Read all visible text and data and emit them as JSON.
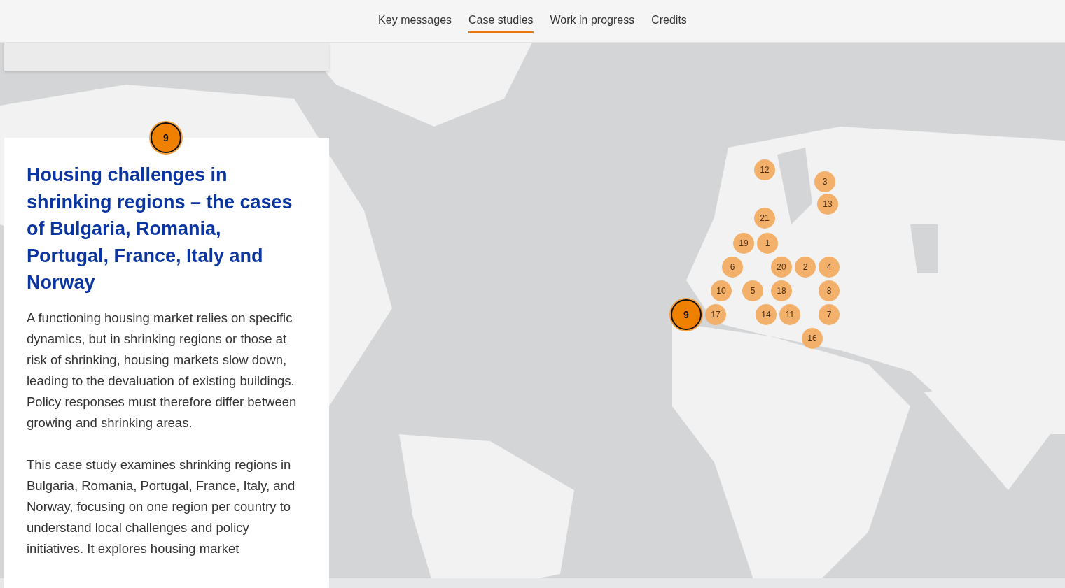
{
  "nav": [
    {
      "label": "Key messages",
      "selected": false
    },
    {
      "label": "Case studies",
      "selected": true
    },
    {
      "label": "Work in progress",
      "selected": false
    },
    {
      "label": "Credits",
      "selected": false
    }
  ],
  "card": {
    "pin": "9",
    "title": "Housing challenges in shrinking regions – the cases of Bulgaria, Romania, Portugal, France, Italy and Norway",
    "paragraphs": [
      "A functioning housing market relies on specific dynamics, but in shrinking regions or those at risk of shrinking, housing markets slow down, leading to the devaluation of existing buildings. Policy responses must therefore differ between growing and shrinking areas.",
      "This case study examines shrinking regions in Bulgaria, Romania, Portugal, France, Italy, and Norway, focusing on one region per country to understand local challenges and policy initiatives. It explores housing market"
    ]
  },
  "map": {
    "kind": "picture",
    "markers": [
      {
        "label": "12",
        "selected": false
      },
      {
        "label": "3",
        "selected": false
      },
      {
        "label": "13",
        "selected": false
      },
      {
        "label": "21",
        "selected": false
      },
      {
        "label": "19",
        "selected": false
      },
      {
        "label": "1",
        "selected": false
      },
      {
        "label": "6",
        "selected": false
      },
      {
        "label": "20",
        "selected": false
      },
      {
        "label": "2",
        "selected": false
      },
      {
        "label": "4",
        "selected": false
      },
      {
        "label": "10",
        "selected": false
      },
      {
        "label": "5",
        "selected": false
      },
      {
        "label": "18",
        "selected": false
      },
      {
        "label": "8",
        "selected": false
      },
      {
        "label": "9",
        "selected": true
      },
      {
        "label": "17",
        "selected": false
      },
      {
        "label": "14",
        "selected": false
      },
      {
        "label": "11",
        "selected": false
      },
      {
        "label": "7",
        "selected": false
      },
      {
        "label": "16",
        "selected": false
      }
    ]
  }
}
